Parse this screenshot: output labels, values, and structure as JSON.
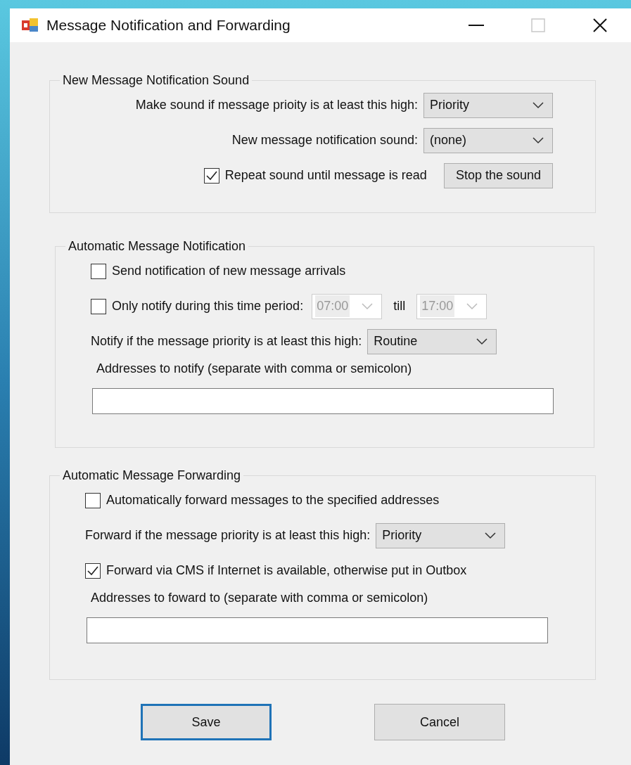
{
  "window": {
    "title": "Message Notification and Forwarding",
    "maximize_disabled": true
  },
  "groups": [
    {
      "title": "New Message Notification Sound",
      "rows": [
        {
          "kind": "select",
          "label": "Make sound if message prioity is at least this high:",
          "value": "Priority"
        },
        {
          "kind": "select",
          "label": "New message notification sound:",
          "value": "(none)"
        },
        {
          "kind": "check",
          "label": "Repeat sound until message is read",
          "checked": true,
          "button": "Stop the sound"
        }
      ]
    },
    {
      "title": "Automatic Message Notification",
      "rows": [
        {
          "kind": "check",
          "label": "Send notification of new message arrivals",
          "checked": false
        },
        {
          "kind": "check",
          "label": "Only notify during this time period:",
          "checked": false,
          "from": {
            "value": "07:00",
            "disabled": true
          },
          "till_label": "till",
          "to": {
            "value": "17:00",
            "disabled": true
          }
        },
        {
          "kind": "select",
          "label": "Notify if the message priority is at least this high:",
          "value": "Routine"
        },
        {
          "kind": "field",
          "label": "Addresses to notify (separate with comma or semicolon)"
        }
      ]
    },
    {
      "title": "Automatic Message Forwarding",
      "rows": [
        {
          "kind": "check",
          "label": "Automatically forward messages to the specified addresses",
          "checked": false
        },
        {
          "kind": "select",
          "label": "Forward if the message priority is at least this high:",
          "value": "Priority"
        },
        {
          "kind": "check",
          "label": "Forward via CMS if Internet is available, otherwise put in Outbox",
          "checked": true
        },
        {
          "kind": "field",
          "label": "Addresses to foward to (separate with comma or semicolon)"
        }
      ]
    }
  ],
  "buttons": [
    {
      "label": "Save",
      "default": true
    },
    {
      "label": "Cancel",
      "default": false
    }
  ]
}
